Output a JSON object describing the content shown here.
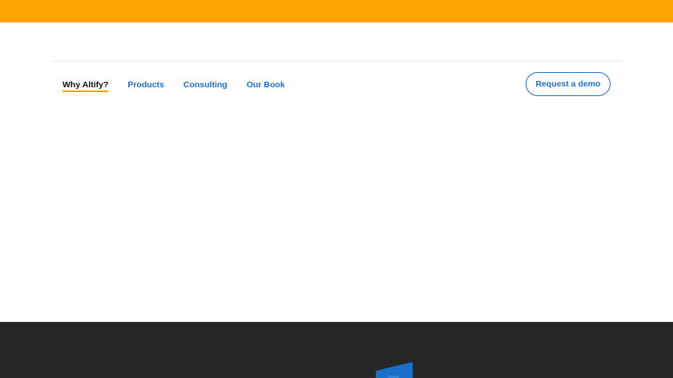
{
  "colors": {
    "top_bar": "#ffa300",
    "nav_link": "#1a6fc9",
    "nav_active": "#111111",
    "active_underline": "#ffa300",
    "dark_section": "#262424",
    "hero_shape": "#1a6fc9"
  },
  "nav": {
    "items": [
      {
        "label": "Why Altify?",
        "active": true
      },
      {
        "label": "Products",
        "active": false
      },
      {
        "label": "Consulting",
        "active": false
      },
      {
        "label": "Our Book",
        "active": false
      }
    ],
    "cta_label": "Request a demo"
  },
  "hero": {
    "icon": "blue-parallelogram-shape"
  }
}
